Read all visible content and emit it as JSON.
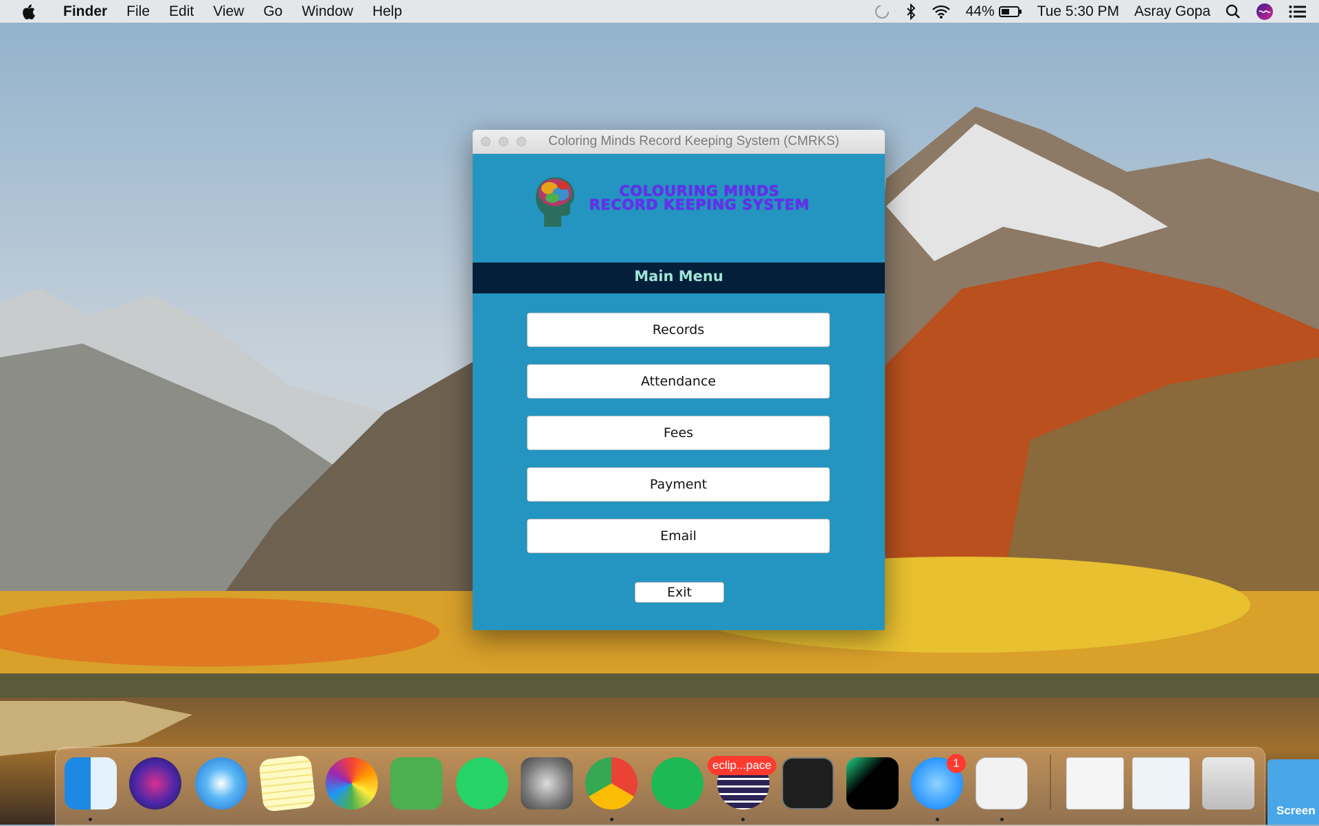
{
  "menubar": {
    "app_name": "Finder",
    "items": [
      "File",
      "Edit",
      "View",
      "Go",
      "Window",
      "Help"
    ],
    "battery": "44%",
    "clock": "Tue 5:30 PM",
    "user": "Asray Gopa"
  },
  "window": {
    "title": "Coloring Minds Record Keeping System (CMRKS)",
    "brand_line1": "COLOURING MINDS",
    "brand_line2": "RECORD KEEPING SYSTEM",
    "section_title": "Main Menu",
    "buttons": [
      "Records",
      "Attendance",
      "Fees",
      "Payment",
      "Email"
    ],
    "exit_label": "Exit"
  },
  "dock": {
    "eclipse_label": "eclip...pace",
    "messages_badge": "1",
    "screenshot_label": "Screen",
    "apps": [
      "finder-icon",
      "siri-icon",
      "safari-icon",
      "notes-icon",
      "photos-icon",
      "facetime-icon",
      "whatsapp-icon",
      "system-preferences-icon",
      "chrome-icon",
      "spotify-icon",
      "eclipse-icon",
      "terminal-icon",
      "pycharm-icon",
      "messages-icon",
      "java-icon",
      "trash-icon"
    ]
  },
  "colors": {
    "window_bg": "#2495c0",
    "banner_bg": "#031f3a",
    "banner_text": "#9fe6d8",
    "brand_text": "#6a2cf0"
  }
}
